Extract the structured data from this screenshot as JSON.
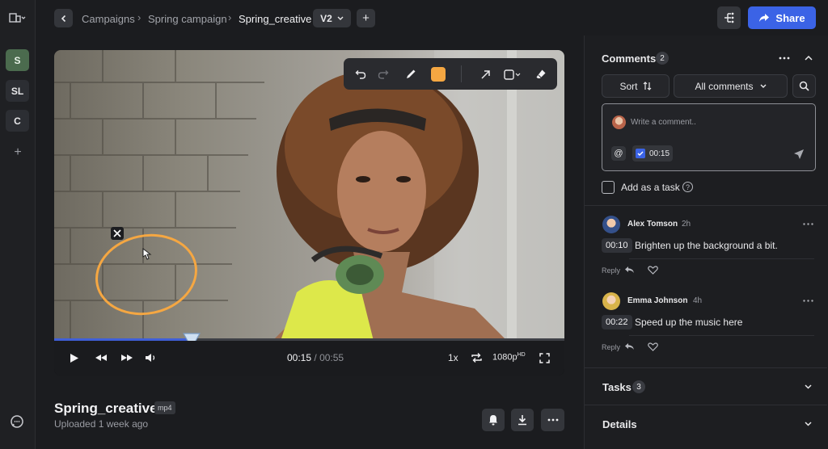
{
  "rail": {
    "workspaces": [
      "S",
      "SL",
      "C"
    ]
  },
  "breadcrumb": {
    "items": [
      "Campaigns",
      "Spring campaign",
      "Spring_creative"
    ]
  },
  "version": {
    "label": "V2"
  },
  "share": {
    "label": "Share"
  },
  "player": {
    "current": "00:15",
    "slash": "/",
    "duration": "00:55",
    "speed": "1x",
    "quality": "1080p",
    "quality_sup": "HD",
    "progress": 0.27,
    "draw_color": "#f5a742"
  },
  "asset": {
    "name": "Spring_creative",
    "ext": "mp4",
    "uploaded": "Uploaded 1 week ago"
  },
  "comments": {
    "title": "Comments",
    "count": "2",
    "sort_label": "Sort",
    "filter_label": "All comments",
    "placeholder": "Write a comment..",
    "timestamp": "00:15",
    "task_label": "Add as a task",
    "items": [
      {
        "author": "Alex Tomson",
        "ago": "2h",
        "time": "00:10",
        "text": "Brighten up the background a bit.",
        "reply": "Reply"
      },
      {
        "author": "Emma Johnson",
        "ago": "4h",
        "time": "00:22",
        "text": "Speed up the music here",
        "reply": "Reply"
      }
    ]
  },
  "tasks": {
    "title": "Tasks",
    "count": "3"
  },
  "details": {
    "title": "Details"
  },
  "colors": {
    "accent": "#3b63e6",
    "annotation": "#f5a742"
  }
}
